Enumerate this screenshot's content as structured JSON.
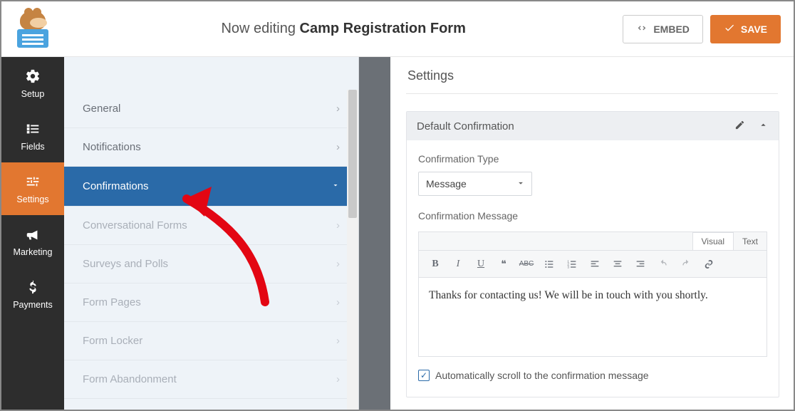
{
  "header": {
    "editing_prefix": "Now editing ",
    "form_name": "Camp Registration Form",
    "embed_label": "EMBED",
    "save_label": "SAVE"
  },
  "leftnav": {
    "items": [
      {
        "key": "setup",
        "label": "Setup",
        "icon": "gear-icon"
      },
      {
        "key": "fields",
        "label": "Fields",
        "icon": "list-icon"
      },
      {
        "key": "settings",
        "label": "Settings",
        "icon": "sliders-icon",
        "active": true
      },
      {
        "key": "marketing",
        "label": "Marketing",
        "icon": "bullhorn-icon"
      },
      {
        "key": "payments",
        "label": "Payments",
        "icon": "dollar-icon"
      }
    ]
  },
  "sidebar": {
    "items": [
      {
        "label": "General"
      },
      {
        "label": "Notifications"
      },
      {
        "label": "Confirmations",
        "active": true
      },
      {
        "label": "Conversational Forms",
        "disabled": true
      },
      {
        "label": "Surveys and Polls",
        "disabled": true
      },
      {
        "label": "Form Pages",
        "disabled": true
      },
      {
        "label": "Form Locker",
        "disabled": true
      },
      {
        "label": "Form Abandonment",
        "disabled": true
      }
    ]
  },
  "main": {
    "heading": "Settings",
    "card_title": "Default Confirmation",
    "type_label": "Confirmation Type",
    "type_selected": "Message",
    "message_label": "Confirmation Message",
    "tabs": {
      "visual": "Visual",
      "text": "Text",
      "active": "visual"
    },
    "toolbar": {
      "bold": "B",
      "italic": "I",
      "underline": "U",
      "quote": "❝",
      "strike": "ᴬᴮᶜ"
    },
    "message_value": "Thanks for contacting us! We will be in touch with you shortly.",
    "autoscroll_label": "Automatically scroll to the confirmation message",
    "autoscroll_checked": true
  },
  "colors": {
    "accent": "#e27730",
    "nav_bg": "#2d2d2d",
    "blue": "#2a6aa8"
  }
}
